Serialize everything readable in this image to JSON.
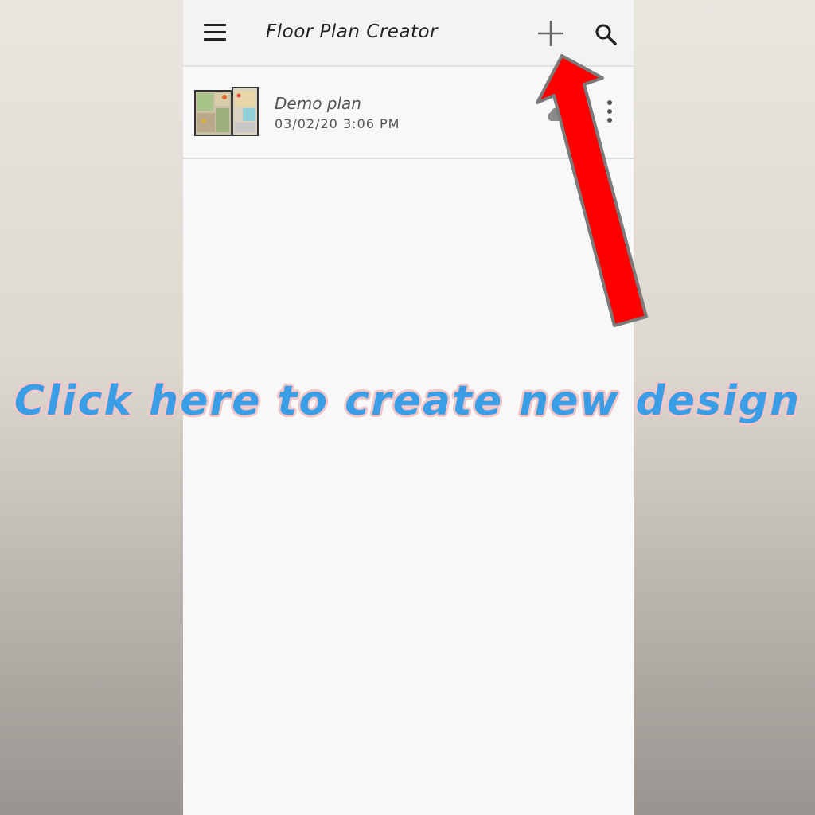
{
  "appbar": {
    "title": "Floor Plan Creator",
    "menu_icon": "hamburger-menu-icon",
    "add_icon": "plus-icon",
    "search_icon": "search-icon"
  },
  "plans": [
    {
      "name": "Demo plan",
      "date": "03/02/20 3:06 PM",
      "thumbnail_icon": "floor-plan-thumbnail",
      "status_icon": "cloud-icon",
      "more_icon": "more-vert-icon"
    }
  ],
  "annotation": {
    "caption": "Click here to create new design",
    "caption_color": "#3a9ee6",
    "caption_outline_color": "#f3c6c8",
    "arrow_color": "#ff0000"
  }
}
